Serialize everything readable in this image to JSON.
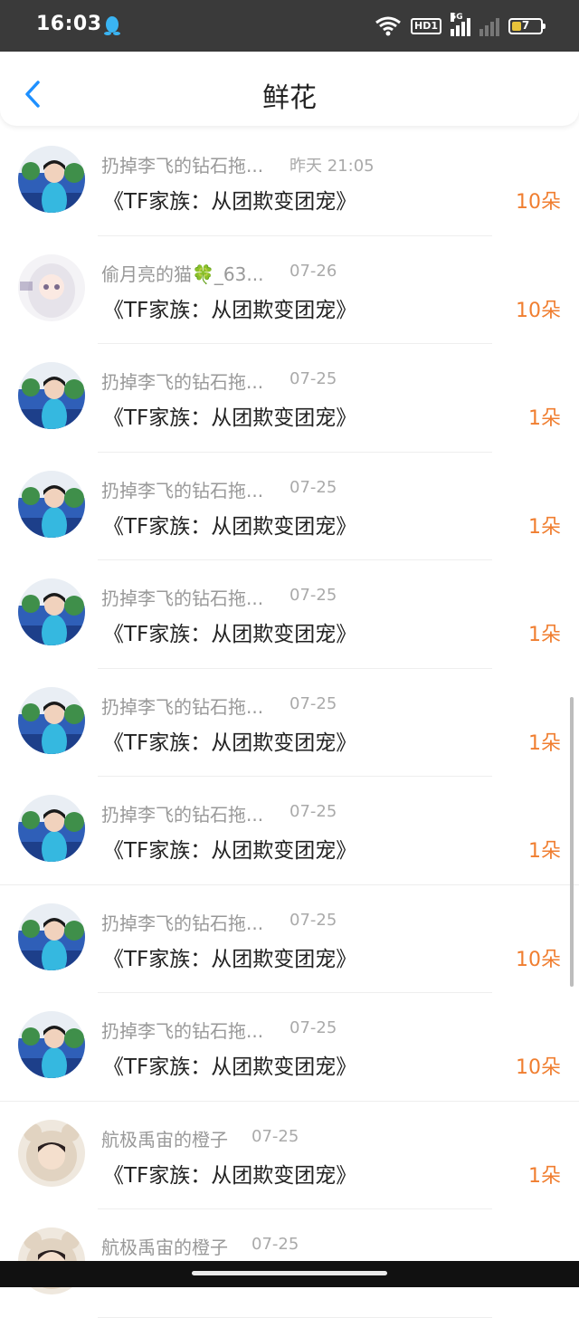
{
  "status_bar": {
    "time": "16:03",
    "hd": "HD1",
    "signal_label": "5G",
    "battery_level": "7",
    "battery_color": "#e8c33a"
  },
  "header": {
    "title": "鲜花"
  },
  "colors": {
    "accent": "#1e90ff",
    "count": "#f07e30"
  },
  "rows": [
    {
      "name": "扔掉李飞的钻石拖...",
      "time": "昨天 21:05",
      "book": "《TF家族：从团欺变团宠》",
      "count": "10朵",
      "avatar": "boy"
    },
    {
      "name": "偷月亮的猫🍀_63...",
      "time": "07-26",
      "book": "《TF家族：从团欺变团宠》",
      "count": "10朵",
      "avatar": "anime"
    },
    {
      "name": "扔掉李飞的钻石拖...",
      "time": "07-25",
      "book": "《TF家族：从团欺变团宠》",
      "count": "1朵",
      "avatar": "boy"
    },
    {
      "name": "扔掉李飞的钻石拖...",
      "time": "07-25",
      "book": "《TF家族：从团欺变团宠》",
      "count": "1朵",
      "avatar": "boy"
    },
    {
      "name": "扔掉李飞的钻石拖...",
      "time": "07-25",
      "book": "《TF家族：从团欺变团宠》",
      "count": "1朵",
      "avatar": "boy"
    },
    {
      "name": "扔掉李飞的钻石拖...",
      "time": "07-25",
      "book": "《TF家族：从团欺变团宠》",
      "count": "1朵",
      "avatar": "boy"
    },
    {
      "name": "扔掉李飞的钻石拖...",
      "time": "07-25",
      "book": "《TF家族：从团欺变团宠》",
      "count": "1朵",
      "avatar": "boy"
    },
    {
      "name": "扔掉李飞的钻石拖...",
      "time": "07-25",
      "book": "《TF家族：从团欺变团宠》",
      "count": "10朵",
      "avatar": "boy"
    },
    {
      "name": "扔掉李飞的钻石拖...",
      "time": "07-25",
      "book": "《TF家族：从团欺变团宠》",
      "count": "10朵",
      "avatar": "boy"
    },
    {
      "name": "航极禹宙的橙子",
      "time": "07-25",
      "book": "《TF家族：从团欺变团宠》",
      "count": "1朵",
      "avatar": "bear"
    },
    {
      "name": "航极禹宙的橙子",
      "time": "07-25",
      "book": "",
      "count": "",
      "avatar": "bear"
    }
  ]
}
